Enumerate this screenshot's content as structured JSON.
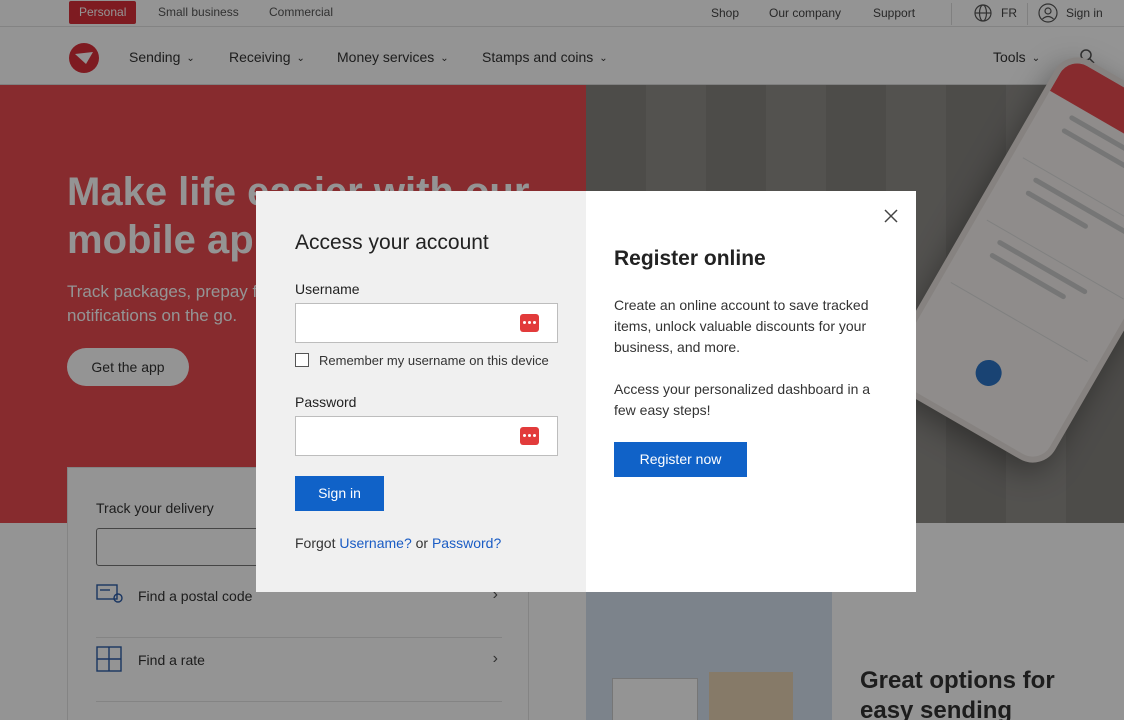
{
  "utility_bar": {
    "segments": [
      "Personal",
      "Small business",
      "Commercial"
    ],
    "links": [
      "Shop",
      "Our company",
      "Support"
    ],
    "language": "FR",
    "sign_in": "Sign in"
  },
  "main_nav": {
    "items": [
      "Sending",
      "Receiving",
      "Money services",
      "Stamps and coins"
    ],
    "tools": "Tools"
  },
  "hero": {
    "title": "Make life easier with our mobile app",
    "subtitle": "Track packages, prepay for shipping, and get delivery notifications on the go.",
    "cta": "Get the app"
  },
  "track": {
    "title": "Track your delivery",
    "rows": [
      "Find a postal code",
      "Find a rate"
    ]
  },
  "promo": {
    "title": "Great options for easy sending"
  },
  "modal": {
    "title": "Access your account",
    "username_label": "Username",
    "remember_label": "Remember my username on this device",
    "password_label": "Password",
    "sign_in_button": "Sign in",
    "forgot_prefix": "Forgot",
    "forgot_username": "Username?",
    "forgot_or": "or",
    "forgot_password": "Password?",
    "register_title": "Register online",
    "register_p1": "Create an online account to save tracked items, unlock valuable discounts for your business, and more.",
    "register_p2": "Access your personalized dashboard in a few easy steps!",
    "register_button": "Register now"
  },
  "colors": {
    "brand_red": "#da2f3a",
    "primary_blue": "#1062c8",
    "link_blue": "#1a5cc4"
  }
}
